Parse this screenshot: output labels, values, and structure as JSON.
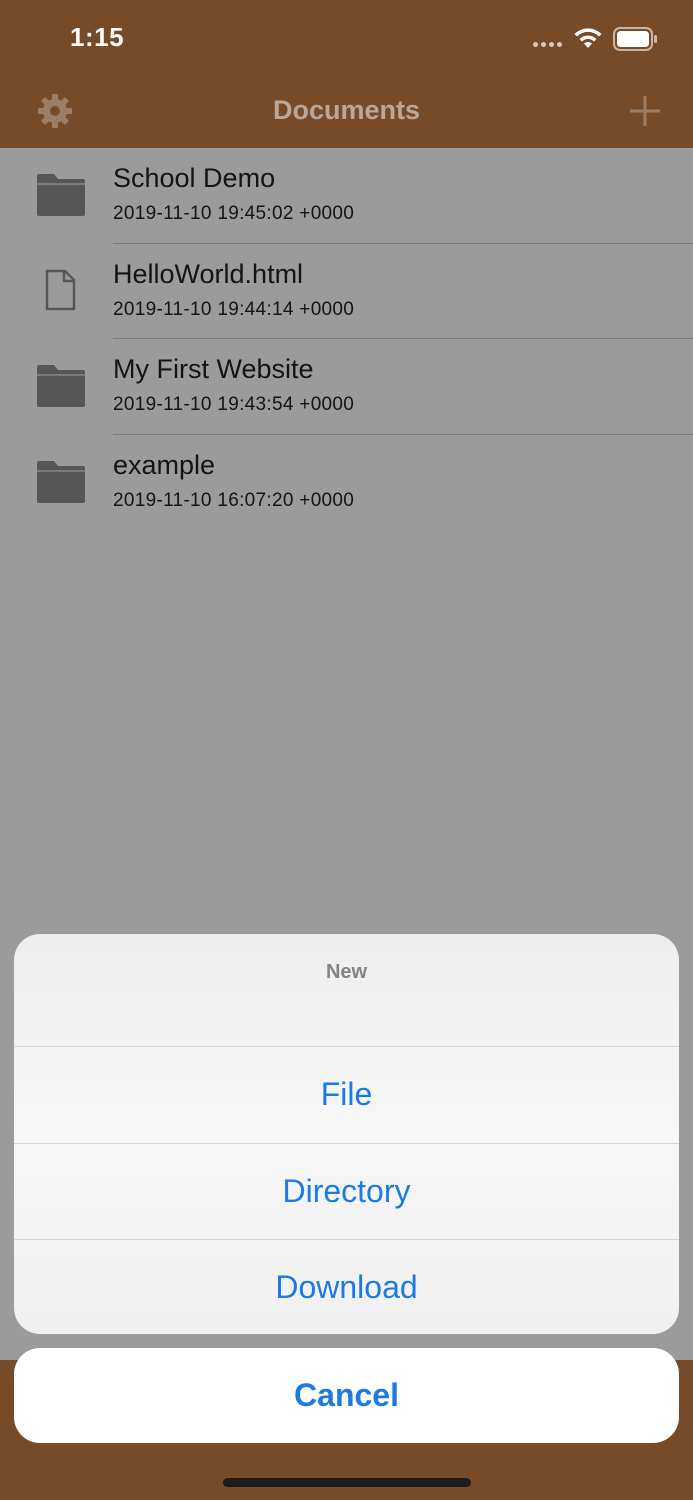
{
  "status_bar": {
    "time": "1:15"
  },
  "nav": {
    "title": "Documents"
  },
  "files": [
    {
      "name": "School Demo",
      "date": "2019-11-10 19:45:02 +0000",
      "kind": "folder-icon"
    },
    {
      "name": "HelloWorld.html",
      "date": "2019-11-10 19:44:14 +0000",
      "kind": "document-icon"
    },
    {
      "name": "My First Website",
      "date": "2019-11-10 19:43:54 +0000",
      "kind": "folder-icon"
    },
    {
      "name": "example",
      "date": "2019-11-10 16:07:20 +0000",
      "kind": "folder-icon"
    }
  ],
  "action_sheet": {
    "title": "New",
    "options": [
      "File",
      "Directory",
      "Download"
    ],
    "cancel": "Cancel"
  },
  "colors": {
    "brand": "#774a28",
    "accent": "#1b7ae6"
  }
}
